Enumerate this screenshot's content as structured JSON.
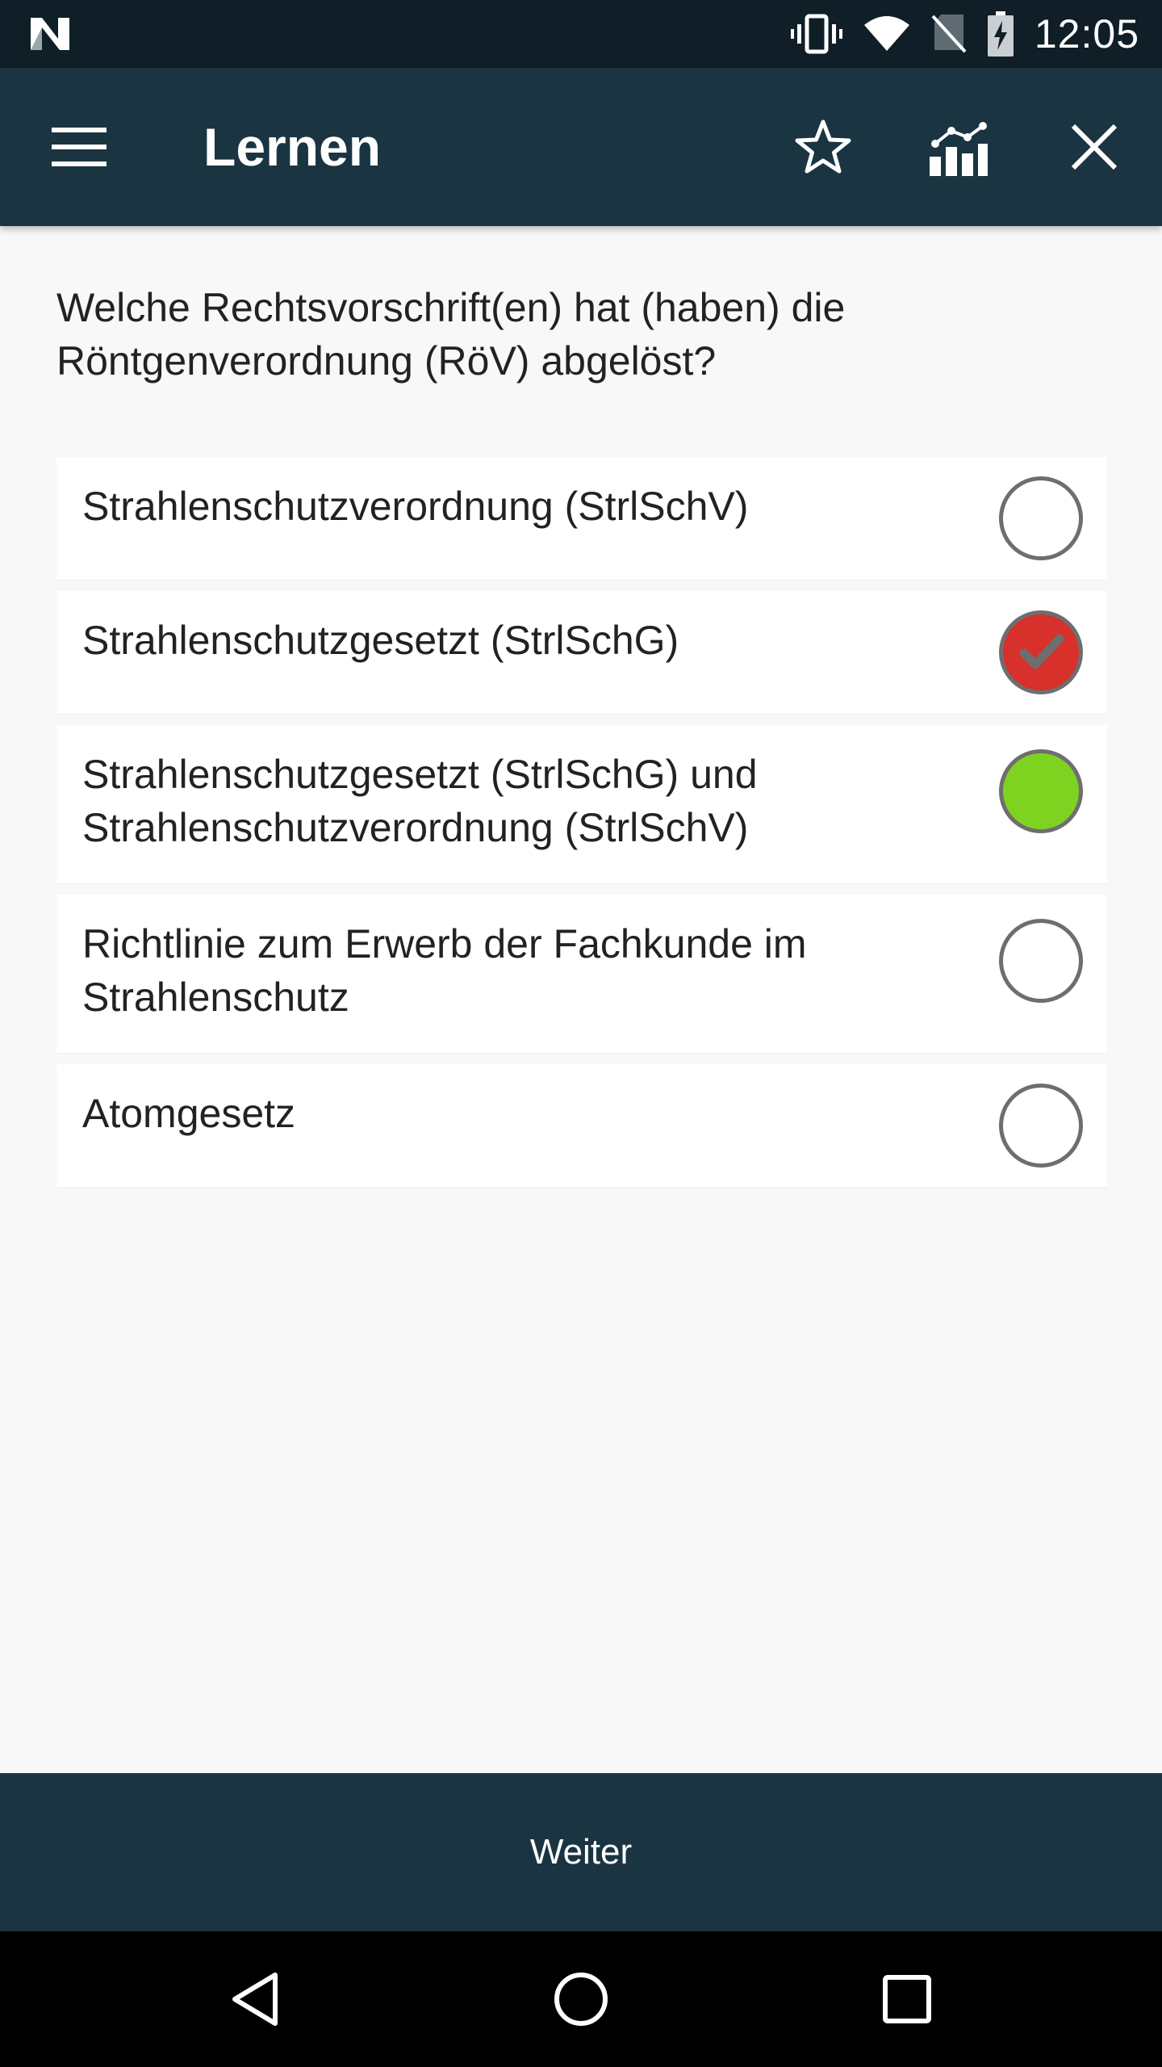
{
  "status_bar": {
    "time": "12:05",
    "icons": [
      "n-logo-icon",
      "vibrate-icon",
      "wifi-icon",
      "no-sim-icon",
      "battery-charging-icon"
    ]
  },
  "app_bar": {
    "title": "Lernen",
    "icons": [
      "menu-icon",
      "star-icon",
      "statistics-icon",
      "close-icon"
    ]
  },
  "question": {
    "text": "Welche Rechtsvorschrift(en) hat (haben) die Röntgenverordnung (RöV) abgelöst?"
  },
  "answers": [
    {
      "text": "Strahlenschutzverordnung (StrlSchV)",
      "state": "unselected"
    },
    {
      "text": "Strahlenschutzgesetzt (StrlSchG)",
      "state": "selected-wrong"
    },
    {
      "text": "Strahlenschutzgesetzt (StrlSchG) und Strahlenschutzverordnung (StrlSchV)",
      "state": "correct"
    },
    {
      "text": "Richtlinie zum Erwerb der Fachkunde im Strahlenschutz",
      "state": "unselected"
    },
    {
      "text": "Atomgesetz",
      "state": "unselected"
    }
  ],
  "bottom_bar": {
    "next_label": "Weiter"
  },
  "colors": {
    "app_bar": "#1b3441",
    "status_bar": "#0f1e27",
    "wrong": "#d8302a",
    "correct": "#7ed321"
  },
  "nav_bar": {
    "icons": [
      "back-icon",
      "home-icon",
      "recents-icon"
    ]
  }
}
